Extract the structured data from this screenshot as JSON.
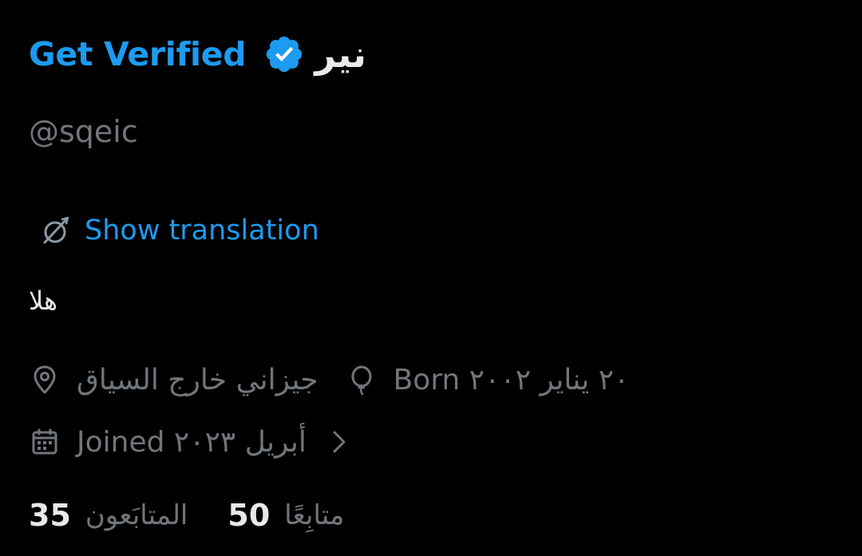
{
  "profile": {
    "get_verified_label": "Get Verified",
    "display_name": "نير",
    "handle": "@sqeic",
    "show_translation_label": "Show translation",
    "bio": "هلا",
    "location": "جيزاني خارج السياق",
    "birthday": "Born ٢٠ يناير ٢٠٠٢",
    "joined": "Joined أبريل ٢٠٢٣",
    "following_count": "35",
    "following_label": "المتابَعون",
    "followers_count": "50",
    "followers_label": "متابِعًا"
  },
  "icons": {
    "verified": "verified-badge-icon",
    "translate": "translate-globe-icon",
    "location": "location-pin-icon",
    "birthday": "balloon-icon",
    "calendar": "calendar-icon",
    "chevron": "chevron-right-icon"
  },
  "colors": {
    "background": "#000000",
    "accent": "#1d9bf0",
    "primary_text": "#e7e9ea",
    "secondary_text": "#71767b"
  }
}
